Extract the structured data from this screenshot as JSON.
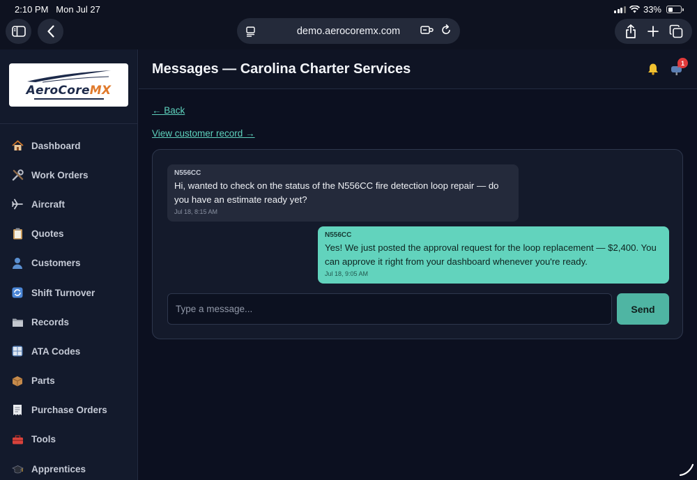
{
  "status_bar": {
    "time": "2:10 PM",
    "date": "Mon Jul 27",
    "battery": "33%"
  },
  "browser": {
    "url": "demo.aerocoremx.com"
  },
  "logo": {
    "part1": "AeroCore",
    "part2": "MX"
  },
  "sidebar": {
    "items": [
      {
        "label": "Dashboard",
        "icon": "house-icon"
      },
      {
        "label": "Work Orders",
        "icon": "tools-icon"
      },
      {
        "label": "Aircraft",
        "icon": "airplane-icon"
      },
      {
        "label": "Quotes",
        "icon": "clipboard-icon"
      },
      {
        "label": "Customers",
        "icon": "person-icon"
      },
      {
        "label": "Shift Turnover",
        "icon": "cycle-icon"
      },
      {
        "label": "Records",
        "icon": "folder-icon"
      },
      {
        "label": "ATA Codes",
        "icon": "numbers-icon"
      },
      {
        "label": "Parts",
        "icon": "package-icon"
      },
      {
        "label": "Purchase Orders",
        "icon": "receipt-icon"
      },
      {
        "label": "Tools",
        "icon": "toolbox-icon"
      },
      {
        "label": "Apprentices",
        "icon": "graduation-cap-icon"
      }
    ]
  },
  "header": {
    "title": "Messages — Carolina Charter Services",
    "mail_badge": "1"
  },
  "links": {
    "back": "← Back",
    "record": "View customer record →"
  },
  "messages": [
    {
      "sender": "N556CC",
      "text": "Hi, wanted to check on the status of the N556CC fire detection loop repair — do you have an estimate ready yet?",
      "time": "Jul 18, 8:15 AM"
    },
    {
      "sender": "N556CC",
      "text": "Yes! We just posted the approval request for the loop replacement — $2,400. You can approve it right from your dashboard whenever you're ready.",
      "time": "Jul 18, 9:05 AM"
    }
  ],
  "composer": {
    "placeholder": "Type a message...",
    "send_label": "Send"
  },
  "colors": {
    "accent": "#5ed2bd",
    "outgoing_bubble": "#62d3bd",
    "incoming_bubble": "#242a3b",
    "badge": "#e03a3a"
  }
}
